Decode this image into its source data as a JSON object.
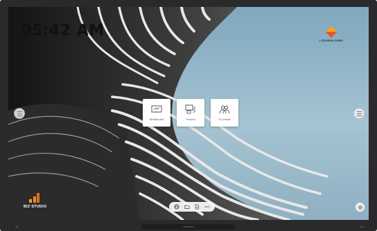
{
  "clock": {
    "time": "05:42 AM"
  },
  "brand": {
    "name": "I-TECHNOLOGIES"
  },
  "tiles": [
    {
      "label": "Whiteboard",
      "icon": "whiteboard-icon"
    },
    {
      "label": "Present",
      "icon": "present-icon"
    },
    {
      "label": "Co-create",
      "icon": "co-create-icon"
    }
  ],
  "biz_logo": {
    "text": "BIZ STUDIO",
    "colors": [
      "#f6a623",
      "#f08c1f",
      "#e86a1a"
    ]
  },
  "dock": {
    "items": [
      "globe-icon",
      "folder-icon",
      "file-icon",
      "more-icon"
    ]
  },
  "bezel": {
    "label": "Unibrand"
  },
  "colors": {
    "accent": "#f08c1f"
  }
}
